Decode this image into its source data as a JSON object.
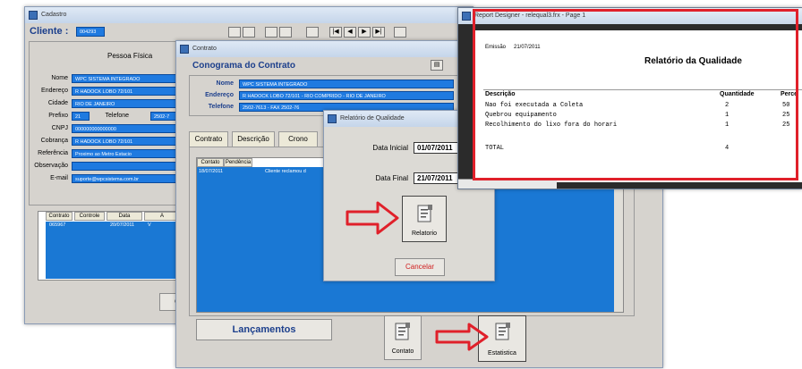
{
  "cadastro": {
    "window_title": "Cadastro",
    "cliente_label": "Cliente :",
    "cliente_code": "004293",
    "section_title": "Pessoa Física",
    "fields": [
      {
        "label": "Nome",
        "value": "WPC SISTEMA INTEGRADO"
      },
      {
        "label": "Endereço",
        "value": "R HADOCK LOBO 72/101"
      },
      {
        "label": "Cidade",
        "value": "RIO DE JANEIRO"
      },
      {
        "label": "Prefixo",
        "value": "21"
      },
      {
        "label": "CNPJ",
        "value": "000000000000000"
      },
      {
        "label": "Cobrança",
        "value": "R HADOCK LOBO 72/101"
      },
      {
        "label": "Referência",
        "value": "Proximo ao Metro Estacio"
      },
      {
        "label": "Observação",
        "value": ""
      },
      {
        "label": "E-mail",
        "value": "suporte@wpcsistema.com.br"
      }
    ],
    "telefone_label": "Telefone",
    "telefone_value": "2502-7",
    "grid_headers": [
      "Contrato",
      "Controle",
      "Data",
      "A"
    ],
    "grid_row": {
      "contrato": "065967",
      "data": "20/07/2011",
      "extra": "V"
    }
  },
  "contrato": {
    "window_title": "Contrato",
    "header": "Conograma do Contrato",
    "fields": [
      {
        "label": "Nome",
        "value": "WPC SISTEMA INTEGRADO"
      },
      {
        "label": "Endereço",
        "value": "R HADOCK LOBO 72/101 - RIO COMPRIDO - RIO DE JANEIRO"
      },
      {
        "label": "Telefone",
        "value": "2502-7613 - FAX 2502-76"
      }
    ],
    "tabs": [
      "Contrato",
      "Descrição",
      "Crono"
    ],
    "grid_headers": [
      "Contato",
      "Pendência"
    ],
    "grid_row": {
      "date": "18/07/2011",
      "text": "Cliente reclamou d"
    },
    "lancamentos_label": "Lançamentos",
    "contato_label": "Contato",
    "estatistica_label": "Estatistica"
  },
  "relatorio_dialog": {
    "window_title": "Relatório de Qualidade",
    "data_inicial_label": "Data Inicial",
    "data_inicial_value": "01/07/2011",
    "data_final_label": "Data Final",
    "data_final_value": "21/07/2011",
    "relatorio_label": "Relatorio",
    "cancelar_label": "Cancelar"
  },
  "report_designer": {
    "window_title": "Report Designer - relequal3.frx - Page 1",
    "emissao_label": "Emissão",
    "emissao_value": "21/07/2011",
    "title": "Relatório da Qualidade",
    "col_descricao": "Descrição",
    "col_quantidade": "Quantidade",
    "col_percentual": "Perce",
    "rows": [
      {
        "desc": "Nao foi executada a Coleta",
        "qty": "2",
        "pct": "50"
      },
      {
        "desc": "Quebrou equipamento",
        "qty": "1",
        "pct": "25"
      },
      {
        "desc": "Recolhimento do lixo fora do horari",
        "qty": "1",
        "pct": "25"
      }
    ],
    "total_label": "TOTAL",
    "total_value": "4"
  },
  "colors": {
    "field_blue": "#1f7ae0",
    "grid_blue": "#1a78d4",
    "highlight_red": "#e0202a",
    "window_gray": "#d6d3ce"
  }
}
